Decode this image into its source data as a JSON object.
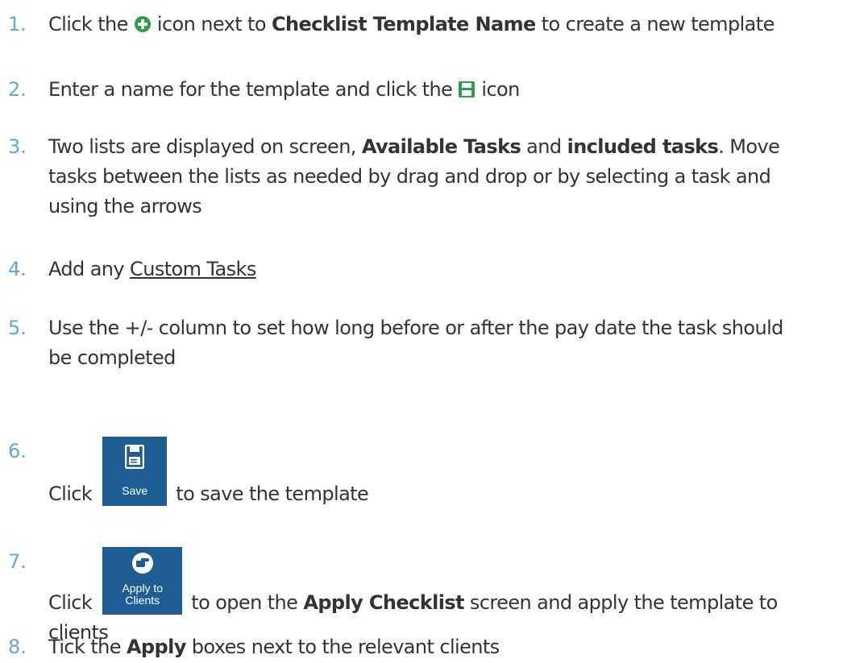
{
  "steps": [
    {
      "number": "1.",
      "pre": "Click the",
      "icon": "add-circle-icon",
      "mid": "icon next to",
      "bold": "Checklist Template Name",
      "post": "to create a new template"
    },
    {
      "number": "2.",
      "pre": "Enter a name for the template and click the",
      "icon": "save-icon",
      "post": "icon"
    },
    {
      "number": "3.",
      "pre": "Two lists are displayed on screen,",
      "bold1": "Available Tasks",
      "and": "and",
      "bold2": "included tasks",
      "post": ". Move",
      "line2": "tasks between the lists as needed by drag and drop or by selecting a task and",
      "line3": "using the arrows"
    },
    {
      "number": "4.",
      "pre": "Add any",
      "link": "Custom Tasks"
    },
    {
      "number": "5.",
      "line1": "Use the +/- column to set how long before or after the pay date the task should",
      "line2": "be completed"
    },
    {
      "number": "6.",
      "pre": "Click",
      "button_label": "Save",
      "button_icon": "floppy-disk-icon",
      "post": "to save the template"
    },
    {
      "number": "7.",
      "pre": "Click",
      "button_label_line1": "Apply to",
      "button_label_line2": "Clients",
      "button_icon": "pointing-hand-icon",
      "post1": "to open the",
      "bold": "Apply Checklist",
      "post2": "screen and apply the template to",
      "line2": "clients"
    },
    {
      "number": "8.",
      "pre": "Tick the",
      "bold": "Apply",
      "post": "boxes next to the relevant clients"
    }
  ],
  "colors": {
    "number": "#5ea8dc",
    "text": "#333333",
    "icon_green": "#2e9e44",
    "button_bg": "#1e5d94"
  }
}
